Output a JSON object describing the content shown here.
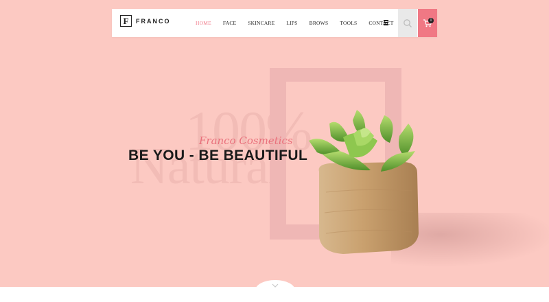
{
  "brand": {
    "logo_letter": "F",
    "name": "FRANCO"
  },
  "nav": {
    "items": [
      {
        "label": "HOME",
        "active": true
      },
      {
        "label": "FACE"
      },
      {
        "label": "SKINCARE"
      },
      {
        "label": "LIPS"
      },
      {
        "label": "BROWS"
      },
      {
        "label": "TOOLS"
      },
      {
        "label": "CONTACT"
      }
    ],
    "menu_icon": "hamburger-icon",
    "search_icon": "search-icon",
    "cart_icon": "cart-icon",
    "cart_count": "0"
  },
  "hero": {
    "script_title": "Franco Cosmetics",
    "headline": "BE YOU - BE BEAUTIFUL",
    "bg_text_top": "100%",
    "bg_text_bottom": "Natural"
  },
  "scroll": {
    "icon": "chevron-down-icon"
  },
  "colors": {
    "background": "#fcc9c2",
    "accent": "#f07884",
    "active_link": "#f07a8a",
    "frame": "#efb7b5"
  }
}
